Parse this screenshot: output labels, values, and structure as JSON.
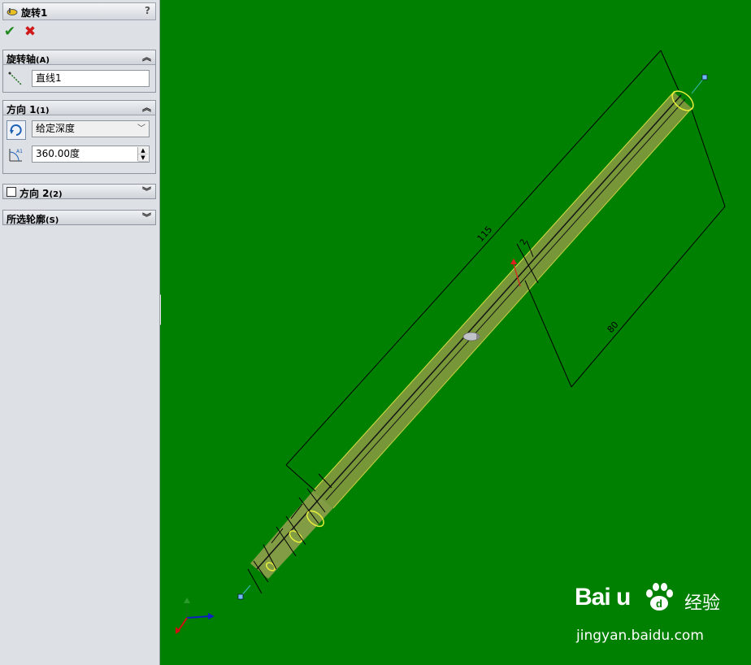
{
  "panel": {
    "title": "旋转1",
    "help": "?",
    "ok_icon": "check-icon",
    "cancel_icon": "x-icon",
    "axis_group": {
      "label": "旋转轴",
      "shortcut": "(A)",
      "value": "直线1"
    },
    "direction1_group": {
      "label": "方向 1",
      "shortcut": "(1)",
      "end_condition": "给定深度",
      "angle": "360.00度"
    },
    "direction2_group": {
      "label": "方向 2",
      "shortcut": "(2)"
    },
    "contours_group": {
      "label": "所选轮廓",
      "shortcut": "(S)"
    }
  },
  "viewport": {
    "background": "#008000",
    "dimensions": [
      "115",
      "80",
      "2"
    ]
  },
  "watermark": {
    "brand": "Bai  u",
    "sub": "经验",
    "url": "jingyan.baidu.com"
  },
  "colors": {
    "ok": "#1e8a1e",
    "cancel": "#d01818",
    "panel_bg": "#dde0e5",
    "model_highlight": "#e8f03a"
  }
}
